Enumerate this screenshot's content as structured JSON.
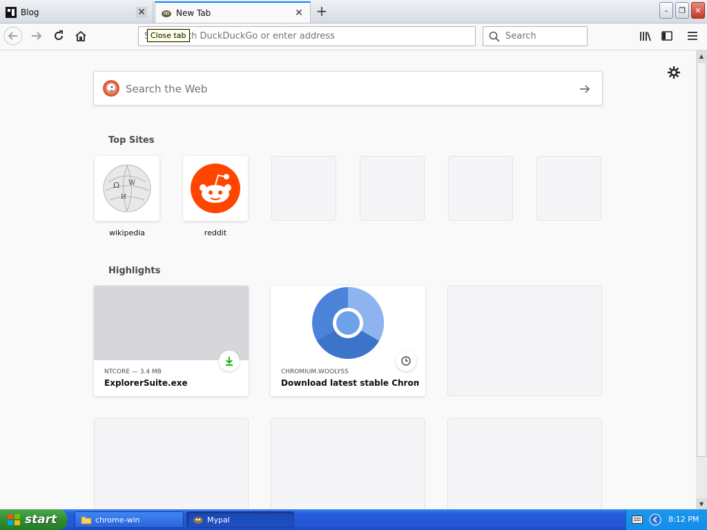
{
  "tabs": [
    {
      "title": "Blog",
      "close_symbol": "✕"
    },
    {
      "title": "New Tab",
      "close_symbol": "✕"
    }
  ],
  "new_tab_symbol": "+",
  "window_controls": {
    "minimize": "–",
    "restore": "❐",
    "close": "✕"
  },
  "navbar": {
    "url_placeholder": "Search with DuckDuckGo or enter address",
    "search_placeholder": "Search"
  },
  "tooltip": "Close tab",
  "newtab": {
    "web_search_placeholder": "Search the Web",
    "top_sites_title": "Top Sites",
    "top_sites": [
      {
        "label": "wikipedia",
        "icon": "wikipedia-icon"
      },
      {
        "label": "reddit",
        "icon": "reddit-icon"
      }
    ],
    "highlights_title": "Highlights",
    "highlights": [
      {
        "context": "NTCORE — 3.4 MB",
        "title": "ExplorerSuite.exe",
        "badge_icon": "download-icon"
      },
      {
        "context": "CHROMIUM.WOOLYSS",
        "title": "Download latest stable Chromiu...",
        "badge_icon": "history-icon"
      }
    ]
  },
  "taskbar": {
    "start_label": "start",
    "items": [
      {
        "label": "chrome-win",
        "icon": "folder-icon"
      },
      {
        "label": "Mypal",
        "icon": "mypal-icon"
      }
    ],
    "clock": "8:12 PM"
  },
  "colors": {
    "accent": "#0a84ff",
    "reddit": "#ff4500",
    "download_green": "#12bc00",
    "chrome_blue": "#4285f4"
  }
}
